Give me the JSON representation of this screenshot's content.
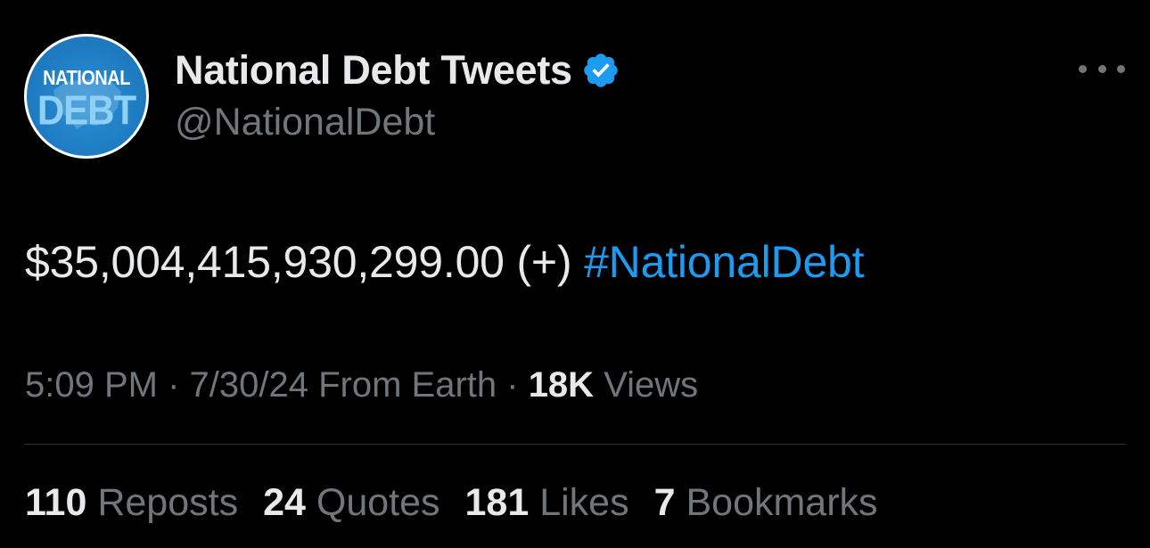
{
  "colors": {
    "background": "#000000",
    "primary_text": "#e7e9ea",
    "secondary_text": "#71767b",
    "link": "#1d9bf0",
    "verified_badge": "#1d9bf0",
    "divider": "#2f3336"
  },
  "author": {
    "avatar_logo_top": "NATIONAL",
    "avatar_logo_bottom": "DEBT",
    "display_name": "National Debt Tweets",
    "verified_icon": "verified-badge-icon",
    "handle": "@NationalDebt",
    "more_icon": "more-options-icon"
  },
  "tweet": {
    "text": "$35,004,415,930,299.00 (+) ",
    "hashtag": "#NationalDebt"
  },
  "meta": {
    "time": "5:09 PM",
    "sep1": " · ",
    "date": "7/30/24",
    "source": " From Earth",
    "sep2": " · ",
    "views_count": "18K",
    "views_label": " Views"
  },
  "stats": [
    {
      "count": "110",
      "label": " Reposts"
    },
    {
      "count": "24",
      "label": " Quotes"
    },
    {
      "count": "181",
      "label": " Likes"
    },
    {
      "count": "7",
      "label": " Bookmarks"
    }
  ]
}
